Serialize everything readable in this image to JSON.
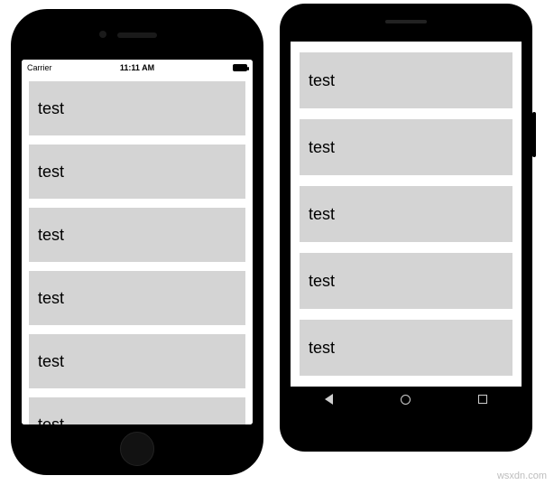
{
  "ios": {
    "statusbar": {
      "carrier": "Carrier",
      "wifi_icon": "wifi",
      "time": "11:11 AM"
    },
    "rows": [
      {
        "label": "test"
      },
      {
        "label": "test"
      },
      {
        "label": "test"
      },
      {
        "label": "test"
      },
      {
        "label": "test"
      },
      {
        "label": "test"
      }
    ]
  },
  "android": {
    "rows": [
      {
        "label": "test"
      },
      {
        "label": "test"
      },
      {
        "label": "test"
      },
      {
        "label": "test"
      },
      {
        "label": "test"
      }
    ],
    "nav": {
      "back": "back",
      "home": "home",
      "recent": "recent"
    }
  },
  "watermark": "wsxdn.com"
}
